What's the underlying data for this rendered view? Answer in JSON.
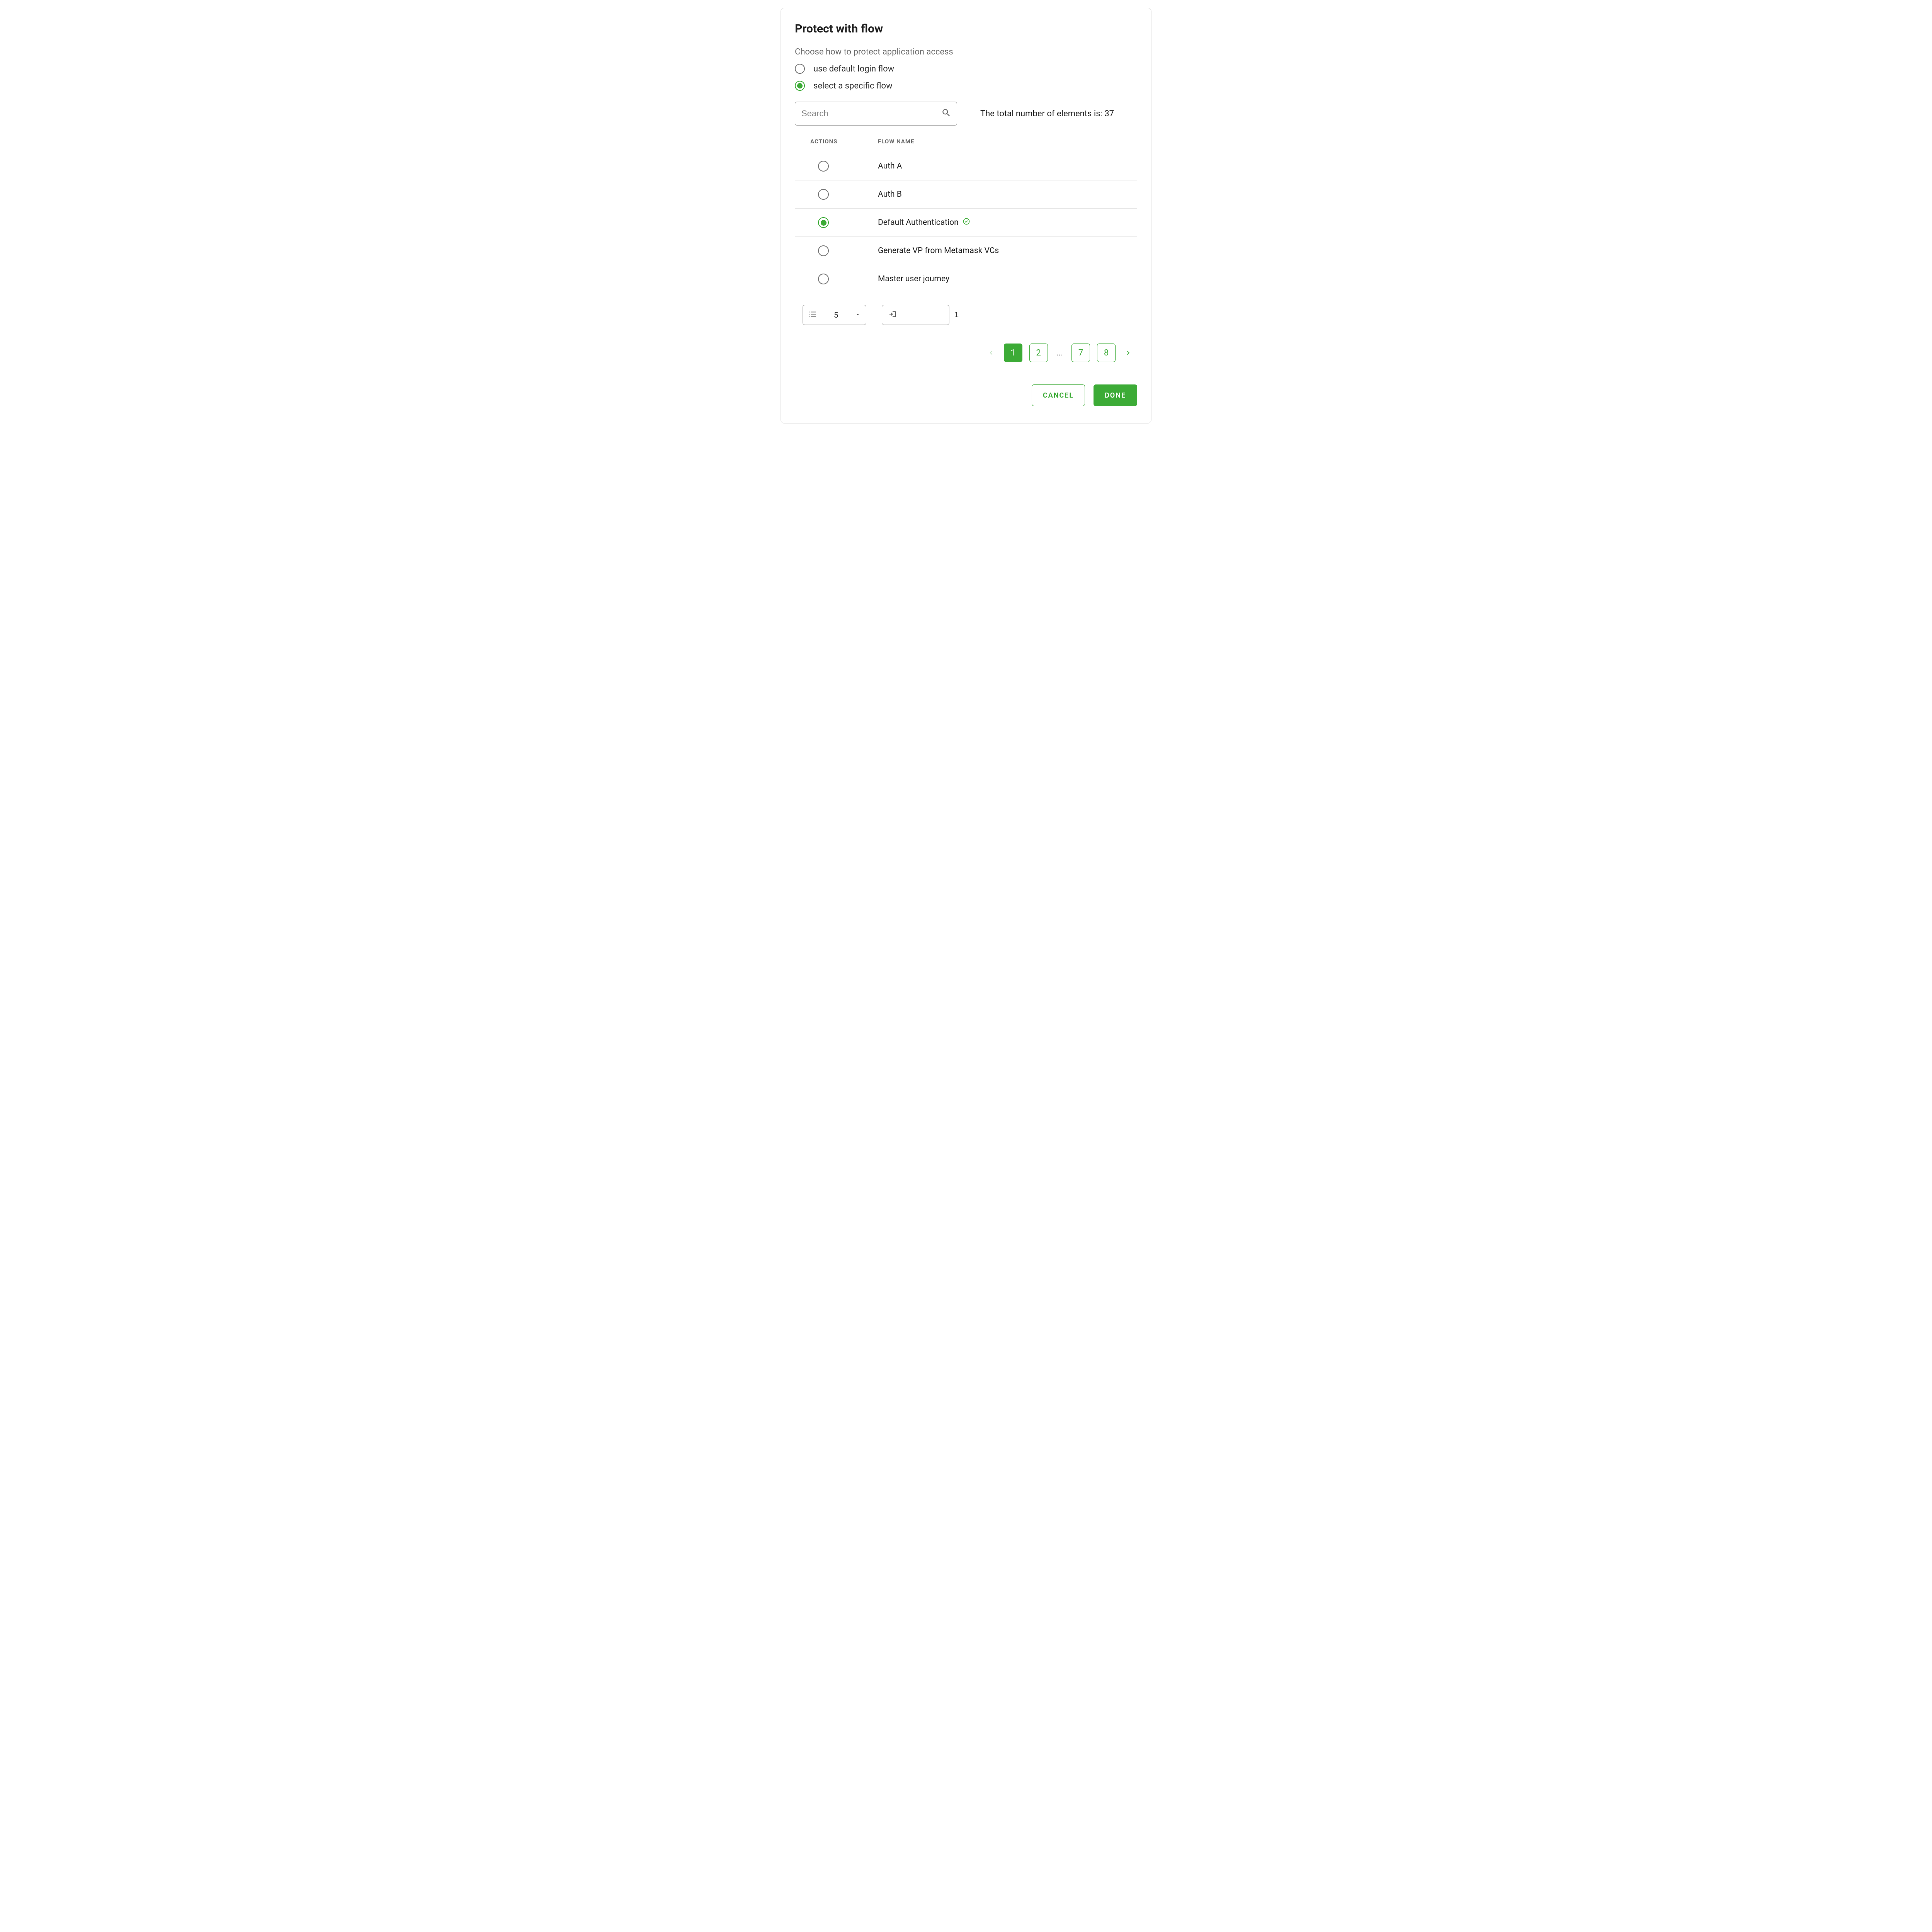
{
  "dialog": {
    "title": "Protect with flow",
    "subtitle": "Choose how to protect application access",
    "options": {
      "default_flow": "use default login flow",
      "specific_flow": "select a specific flow",
      "selected": "specific_flow"
    }
  },
  "search": {
    "placeholder": "Search",
    "value": ""
  },
  "total": {
    "prefix": "The total number of elements is: ",
    "count": "37"
  },
  "table": {
    "headers": {
      "actions": "ACTIONS",
      "flow_name": "FLOW NAME"
    },
    "rows": [
      {
        "name": "Auth A",
        "selected": false,
        "default": false
      },
      {
        "name": "Auth B",
        "selected": false,
        "default": false
      },
      {
        "name": "Default Authentication",
        "selected": true,
        "default": true
      },
      {
        "name": "Generate VP from Metamask VCs",
        "selected": false,
        "default": false
      },
      {
        "name": "Master user journey",
        "selected": false,
        "default": false
      }
    ]
  },
  "paging": {
    "rows_per_page": "5",
    "current_page_input": "1",
    "pages": [
      "1",
      "2",
      "7",
      "8"
    ],
    "ellipsis": "...",
    "active_page": "1"
  },
  "buttons": {
    "cancel": "CANCEL",
    "done": "DONE"
  }
}
